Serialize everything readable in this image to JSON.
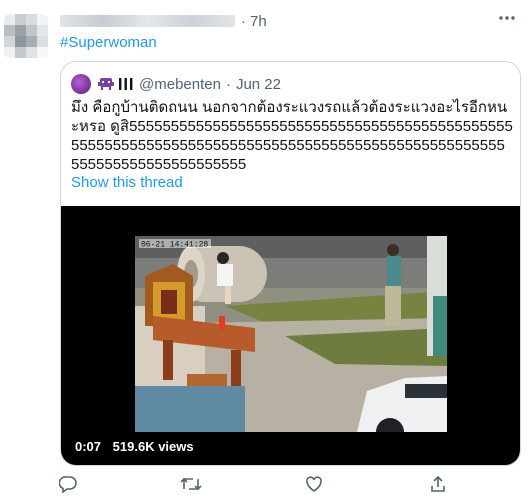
{
  "tweet": {
    "time": "7h",
    "hashtag": "#Superwoman",
    "more_icon": "more-icon"
  },
  "quote": {
    "handle": "@mebenten",
    "sep": "·",
    "date": "Jun 22",
    "text": "มึง คือกูบ้านติดถนน นอกจากต้องระแวงรถแล้วต้องระแวงอะไรอีกหนะหรอ ดูสิ55555555555555555555555555555555555555555555555555555555555555555555555555555555555555555555555555555555555555555555555",
    "show_thread": "Show this thread"
  },
  "video": {
    "timestamp_overlay": "06-21 14:41:28",
    "elapsed": "0:07",
    "views": "519.6K views"
  },
  "actions": {
    "reply_icon": "reply-icon",
    "retweet_icon": "retweet-icon",
    "like_icon": "like-icon",
    "share_icon": "share-icon"
  }
}
